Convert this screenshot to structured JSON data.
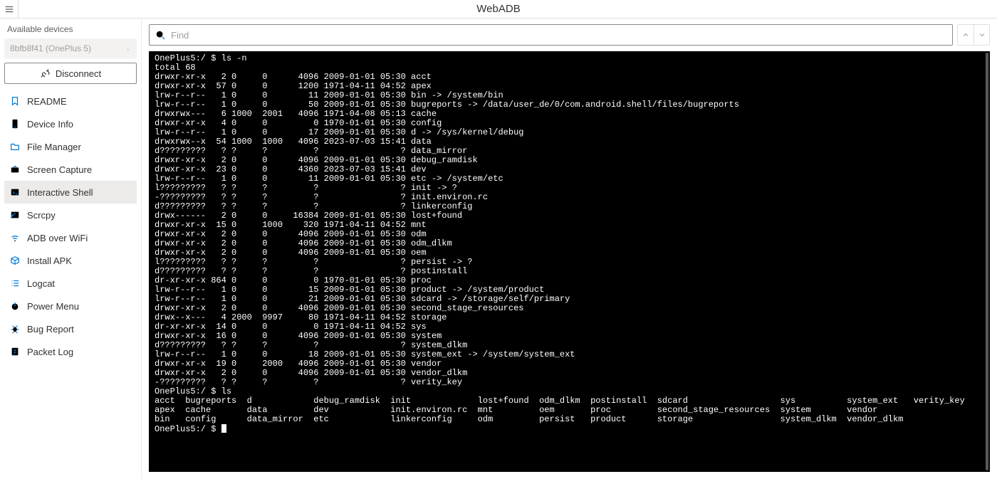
{
  "header": {
    "title": "WebADB"
  },
  "sidebar": {
    "section_label": "Available devices",
    "device_selected": "8bfb8f41 (OnePlus 5)",
    "disconnect_label": "Disconnect",
    "items": [
      {
        "icon": "bookmark-icon",
        "label": "README"
      },
      {
        "icon": "phone-icon",
        "label": "Device Info"
      },
      {
        "icon": "folder-icon",
        "label": "File Manager"
      },
      {
        "icon": "camera-icon",
        "label": "Screen Capture"
      },
      {
        "icon": "terminal-icon",
        "label": "Interactive Shell",
        "active": true
      },
      {
        "icon": "cast-icon",
        "label": "Scrcpy"
      },
      {
        "icon": "wifi-icon",
        "label": "ADB over WiFi"
      },
      {
        "icon": "package-icon",
        "label": "Install APK"
      },
      {
        "icon": "list-icon",
        "label": "Logcat"
      },
      {
        "icon": "power-icon",
        "label": "Power Menu"
      },
      {
        "icon": "bug-icon",
        "label": "Bug Report"
      },
      {
        "icon": "log-icon",
        "label": "Packet Log"
      }
    ]
  },
  "find": {
    "placeholder": "Find"
  },
  "terminal": {
    "prompt": "OnePlus5:/ $ ",
    "cmd1": "ls -n",
    "total": "total 68",
    "ls_long": [
      "drwxr-xr-x   2 0     0      4096 2009-01-01 05:30 acct",
      "drwxr-xr-x  57 0     0      1200 1971-04-11 04:52 apex",
      "lrw-r--r--   1 0     0        11 2009-01-01 05:30 bin -> /system/bin",
      "lrw-r--r--   1 0     0        50 2009-01-01 05:30 bugreports -> /data/user_de/0/com.android.shell/files/bugreports",
      "drwxrwx---   6 1000  2001   4096 1971-04-08 05:13 cache",
      "drwxr-xr-x   4 0     0         0 1970-01-01 05:30 config",
      "lrw-r--r--   1 0     0        17 2009-01-01 05:30 d -> /sys/kernel/debug",
      "drwxrwx--x  54 1000  1000   4096 2023-07-03 15:41 data",
      "d?????????   ? ?     ?         ?                ? data_mirror",
      "drwxr-xr-x   2 0     0      4096 2009-01-01 05:30 debug_ramdisk",
      "drwxr-xr-x  23 0     0      4360 2023-07-03 15:41 dev",
      "lrw-r--r--   1 0     0        11 2009-01-01 05:30 etc -> /system/etc",
      "l?????????   ? ?     ?         ?                ? init -> ?",
      "-?????????   ? ?     ?         ?                ? init.environ.rc",
      "d?????????   ? ?     ?         ?                ? linkerconfig",
      "drwx------   2 0     0     16384 2009-01-01 05:30 lost+found",
      "drwxr-xr-x  15 0     1000    320 1971-04-11 04:52 mnt",
      "drwxr-xr-x   2 0     0      4096 2009-01-01 05:30 odm",
      "drwxr-xr-x   2 0     0      4096 2009-01-01 05:30 odm_dlkm",
      "drwxr-xr-x   2 0     0      4096 2009-01-01 05:30 oem",
      "l?????????   ? ?     ?         ?                ? persist -> ?",
      "d?????????   ? ?     ?         ?                ? postinstall",
      "dr-xr-xr-x 864 0     0         0 1970-01-01 05:30 proc",
      "lrw-r--r--   1 0     0        15 2009-01-01 05:30 product -> /system/product",
      "lrw-r--r--   1 0     0        21 2009-01-01 05:30 sdcard -> /storage/self/primary",
      "drwxr-xr-x   2 0     0      4096 2009-01-01 05:30 second_stage_resources",
      "drwx--x---   4 2000  9997     80 1971-04-11 04:52 storage",
      "dr-xr-xr-x  14 0     0         0 1971-04-11 04:52 sys",
      "drwxr-xr-x  16 0     0      4096 2009-01-01 05:30 system",
      "d?????????   ? ?     ?         ?                ? system_dlkm",
      "lrw-r--r--   1 0     0        18 2009-01-01 05:30 system_ext -> /system/system_ext",
      "drwxr-xr-x  19 0     2000   4096 2009-01-01 05:30 vendor",
      "drwxr-xr-x   2 0     0      4096 2009-01-01 05:30 vendor_dlkm",
      "-?????????   ? ?     ?         ?                ? verity_key"
    ],
    "cmd2": "ls",
    "ls_cols": [
      "acct  bugreports  d            debug_ramdisk  init             lost+found  odm_dlkm  postinstall  sdcard                  sys          system_ext   verity_key",
      "apex  cache       data         dev            init.environ.rc  mnt         oem       proc         second_stage_resources  system       vendor",
      "bin   config      data_mirror  etc            linkerconfig     odm         persist   product      storage                 system_dlkm  vendor_dlkm"
    ]
  }
}
